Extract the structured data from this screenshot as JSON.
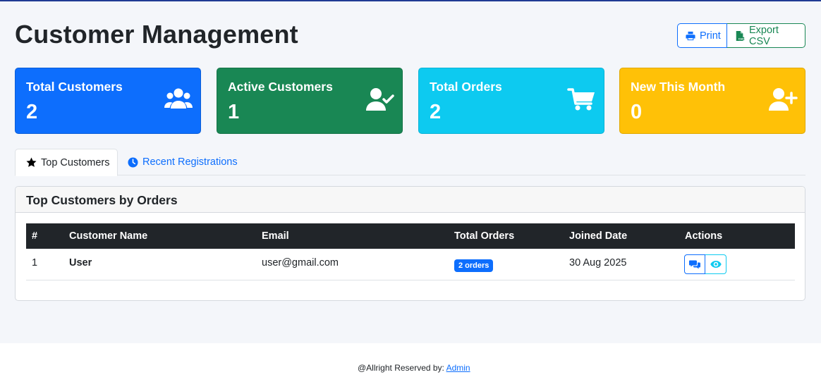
{
  "page": {
    "title": "Customer Management"
  },
  "toolbar": {
    "print_label": "Print",
    "export_label": "Export CSV"
  },
  "stats": [
    {
      "label": "Total Customers",
      "value": "2",
      "icon": "users-icon",
      "color": "#0d6efd"
    },
    {
      "label": "Active Customers",
      "value": "1",
      "icon": "user-check-icon",
      "color": "#198754"
    },
    {
      "label": "Total Orders",
      "value": "2",
      "icon": "shopping-cart-icon",
      "color": "#0dcaf0"
    },
    {
      "label": "New This Month",
      "value": "0",
      "icon": "user-plus-icon",
      "color": "#ffc107"
    }
  ],
  "tabs": [
    {
      "label": "Top Customers",
      "icon": "star-icon",
      "active": true
    },
    {
      "label": "Recent Registrations",
      "icon": "clock-icon",
      "active": false
    }
  ],
  "panel": {
    "title": "Top Customers by Orders",
    "columns": [
      "#",
      "Customer Name",
      "Email",
      "Total Orders",
      "Joined Date",
      "Actions"
    ],
    "rows": [
      {
        "index": "1",
        "name": "User",
        "email": "user@gmail.com",
        "orders": "2 orders",
        "joined": "30 Aug 2025"
      }
    ]
  },
  "footer": {
    "text": "@Allright Reserved by:",
    "link": "Admin"
  }
}
